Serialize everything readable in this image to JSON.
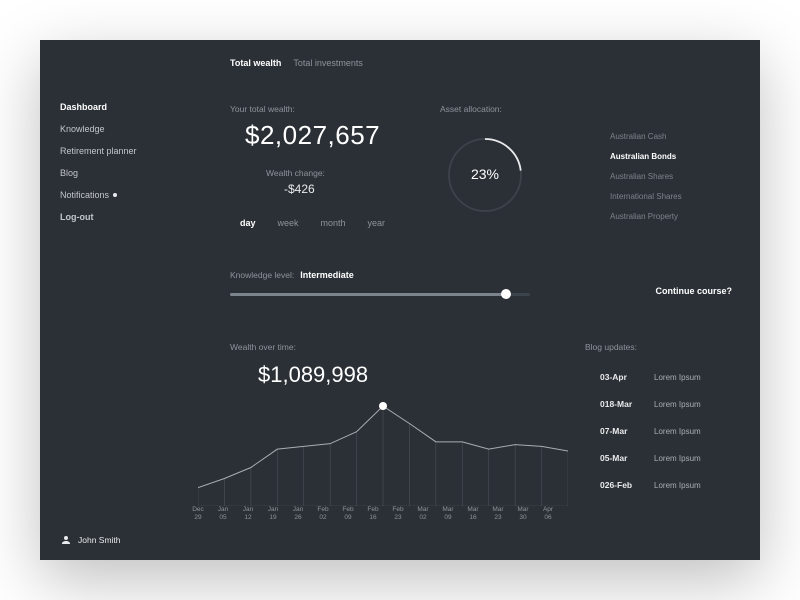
{
  "sidebar": {
    "items": [
      {
        "label": "Dashboard",
        "active": true
      },
      {
        "label": "Knowledge",
        "active": false
      },
      {
        "label": "Retirement planner",
        "active": false
      },
      {
        "label": "Blog",
        "active": false
      },
      {
        "label": "Notifications",
        "active": false,
        "badge": true
      },
      {
        "label": "Log-out",
        "active": false,
        "heavy": true
      }
    ]
  },
  "user": {
    "name": "John Smith"
  },
  "tabs": {
    "items": [
      {
        "label": "Total wealth",
        "active": true
      },
      {
        "label": "Total investments",
        "active": false
      }
    ]
  },
  "wealth": {
    "label": "Your total wealth:",
    "value": "$2,027,657",
    "change_label": "Wealth change:",
    "change_value": "-$426",
    "periods": [
      "day",
      "week",
      "month",
      "year"
    ],
    "period_active": "day"
  },
  "allocation": {
    "label": "Asset allocation:",
    "percent_label": "23%",
    "selected_index": 1,
    "legend": [
      "Australian Cash",
      "Australian Bonds",
      "Australian Shares",
      "International Shares",
      "Australian Property"
    ]
  },
  "knowledge": {
    "label": "Knowledge level:",
    "value": "Intermediate",
    "progress_pct": 92,
    "cta": "Continue course?"
  },
  "wot": {
    "label": "Wealth over time:",
    "value": "$1,089,998"
  },
  "blog": {
    "label": "Blog updates:",
    "items": [
      {
        "date": "03-Apr",
        "title": "Lorem Ipsum"
      },
      {
        "date": "018-Mar",
        "title": "Lorem Ipsum"
      },
      {
        "date": "07-Mar",
        "title": "Lorem Ipsum"
      },
      {
        "date": "05-Mar",
        "title": "Lorem Ipsum"
      },
      {
        "date": "026-Feb",
        "title": "Lorem Ipsum"
      }
    ]
  },
  "chart_data": {
    "type": "line",
    "title": "Wealth over time",
    "categories": [
      "Dec 29",
      "Jan 05",
      "Jan 12",
      "Jan 19",
      "Jan 26",
      "Feb 02",
      "Feb 09",
      "Feb 16",
      "Feb 23",
      "Mar 02",
      "Mar 09",
      "Mar 16",
      "Mar 23",
      "Mar 30",
      "Apr 06"
    ],
    "values": [
      200000,
      300000,
      420000,
      620000,
      650000,
      680000,
      810000,
      1089998,
      900000,
      700000,
      700000,
      620000,
      670000,
      650000,
      600000
    ],
    "ylim": [
      0,
      1200000
    ],
    "marker_index": 7,
    "donut": {
      "percent": 23
    }
  }
}
